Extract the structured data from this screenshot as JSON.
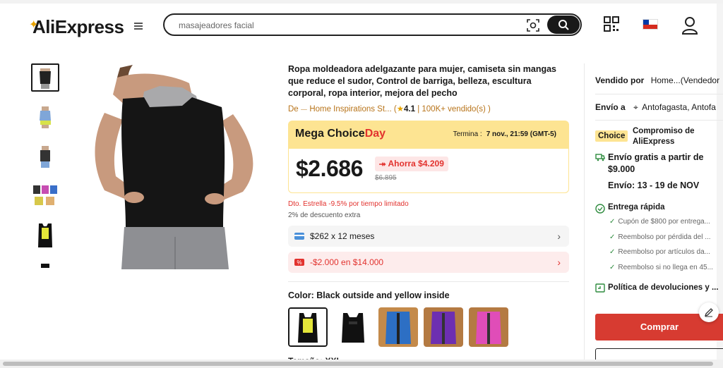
{
  "header": {
    "logo": "AliExpress",
    "search": {
      "placeholder": "masajeadores facial"
    }
  },
  "product": {
    "title": "Ropa moldeadora adelgazante para mujer, camiseta sin mangas que reduce el sudor, Control de barriga, belleza, escultura corporal, ropa interior, mejora del pecho",
    "store_prefix": "De",
    "store_name": "Home Inspirations St...",
    "rating": "4.1",
    "sold": "100K+ vendido(s)",
    "mega": {
      "title_main": "Mega Choice",
      "title_accent": "Day",
      "ends_label": "Termina :",
      "ends_value": "7 nov., 21:59 (GMT-5)"
    },
    "price": "$2.686",
    "saving": "Ahorra $4.209",
    "old_price": "$6.895",
    "discount_star": "Dto. Estrella -9.5% por tiempo limitado",
    "discount_extra": "2% de descuento extra",
    "installments": "$262 x 12 meses",
    "coupon": "-$2.000 en $14.000",
    "color_label": "Color: Black outside and yellow inside",
    "next_section_cut": "Tamaño: XXL"
  },
  "panel": {
    "sold_by_label": "Vendido por",
    "sold_by_value": "Home...(Vendedor",
    "ship_to_label": "Envío a",
    "ship_to_value": "Antofagasta, Antofa",
    "choice_badge": "Choice",
    "choice_text": "Compromiso de AliExpress",
    "free_shipping": "Envío gratis a partir de $9.000",
    "ship_dates": "Envío: 13 - 19 de NOV",
    "fast_delivery": "Entrega rápida",
    "bullets": [
      "Cupón de $800 por entrega...",
      "Reembolso por pérdida del ...",
      "Reembolso por artículos da...",
      "Reembolso si no llega en 45..."
    ],
    "returns": "Política de devoluciones y ...",
    "buy_label": "Comprar"
  },
  "colors": {
    "accent": "#e2322e",
    "choice_yellow": "#fde492",
    "buy": "#d73b31",
    "store": "#b8741a"
  }
}
